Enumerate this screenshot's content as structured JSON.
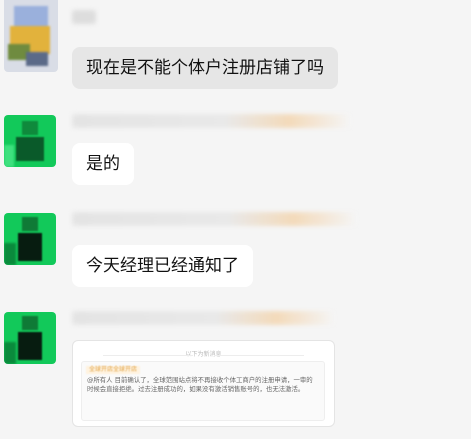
{
  "messages": [
    {
      "type": "text",
      "text": "现在是不能个体户注册店铺了吗",
      "bubble_color": "#e6e6e6"
    },
    {
      "type": "text",
      "text": "是的",
      "bubble_color": "#ffffff"
    },
    {
      "type": "text",
      "text": "今天经理已经通知了",
      "bubble_color": "#ffffff"
    },
    {
      "type": "quote-card",
      "divider": "以下为新消息",
      "tag": "全球开店全球开店",
      "body": "@所有人 目前确认了，全球范围站点将不再接收个体工商户的注册申请，一审的时候会直接拒绝。过去注册成功的，如果没有激活销售账号的，也无法激活。"
    }
  ],
  "colors": {
    "background": "#f5f5f5",
    "bubble": "#ffffff",
    "own_bubble": "#e6e6e6",
    "avatar_green": "#12c95a"
  }
}
